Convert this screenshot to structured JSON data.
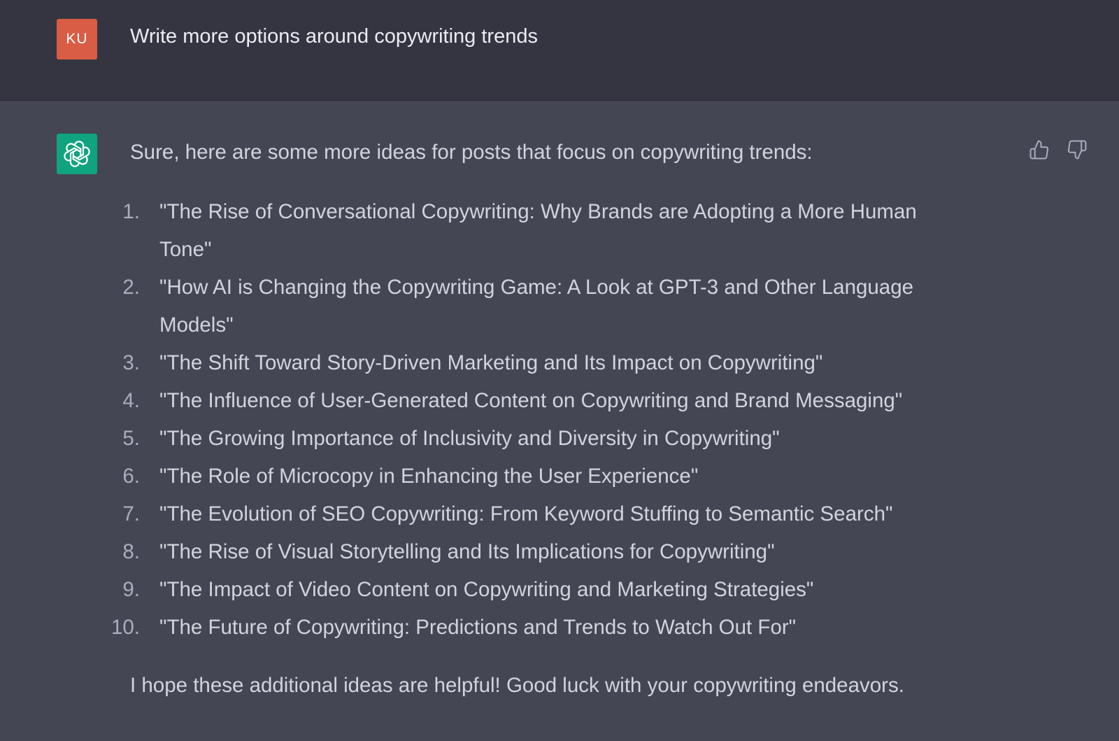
{
  "user_message": {
    "avatar_initials": "KU",
    "text": "Write more options around copywriting trends"
  },
  "assistant_message": {
    "avatar_icon": "openai-logo-icon",
    "intro": "Sure, here are some more ideas for posts that focus on copywriting trends:",
    "items": [
      {
        "num": "1.",
        "text": "\"The Rise of Conversational Copywriting: Why Brands are Adopting a More Human Tone\""
      },
      {
        "num": "2.",
        "text": "\"How AI is Changing the Copywriting Game: A Look at GPT-3 and Other Language Models\""
      },
      {
        "num": "3.",
        "text": "\"The Shift Toward Story-Driven Marketing and Its Impact on Copywriting\""
      },
      {
        "num": "4.",
        "text": "\"The Influence of User-Generated Content on Copywriting and Brand Messaging\""
      },
      {
        "num": "5.",
        "text": "\"The Growing Importance of Inclusivity and Diversity in Copywriting\""
      },
      {
        "num": "6.",
        "text": "\"The Role of Microcopy in Enhancing the User Experience\""
      },
      {
        "num": "7.",
        "text": "\"The Evolution of SEO Copywriting: From Keyword Stuffing to Semantic Search\""
      },
      {
        "num": "8.",
        "text": "\"The Rise of Visual Storytelling and Its Implications for Copywriting\""
      },
      {
        "num": "9.",
        "text": "\"The Impact of Video Content on Copywriting and Marketing Strategies\""
      },
      {
        "num": "10.",
        "text": "\"The Future of Copywriting: Predictions and Trends to Watch Out For\""
      }
    ],
    "outro": "I hope these additional ideas are helpful! Good luck with your copywriting endeavors."
  },
  "feedback": {
    "up_icon": "thumbs-up-icon",
    "down_icon": "thumbs-down-icon"
  },
  "colors": {
    "user_bg": "#343541",
    "assistant_bg": "#444654",
    "user_avatar": "#d95c45",
    "bot_avatar": "#10a37f"
  }
}
